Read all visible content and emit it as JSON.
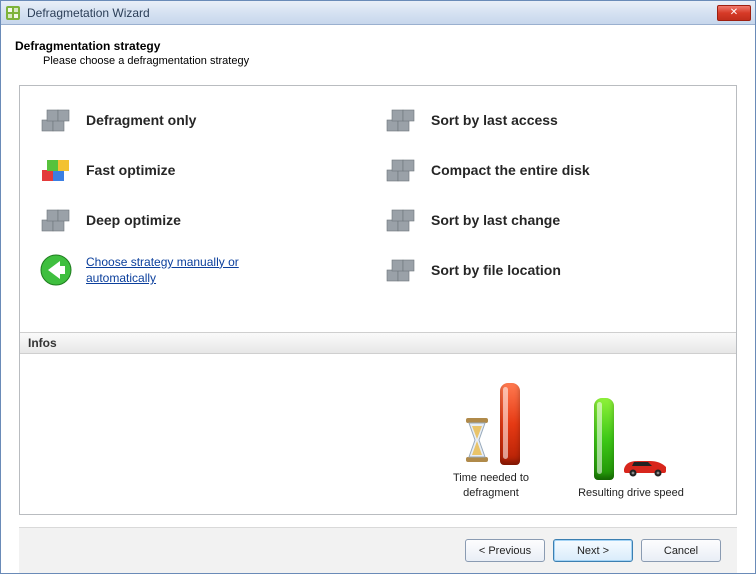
{
  "window": {
    "title": "Defragmetation Wizard"
  },
  "header": {
    "title": "Defragmentation strategy",
    "subtitle": "Please choose a defragmentation strategy"
  },
  "options_left": [
    {
      "label": "Defragment only",
      "icon": "blocks-gray"
    },
    {
      "label": "Fast optimize",
      "icon": "blocks-color"
    },
    {
      "label": "Deep optimize",
      "icon": "blocks-gray"
    }
  ],
  "options_left_link": {
    "label": "Choose strategy manually or automatically",
    "icon": "back-arrow"
  },
  "options_right": [
    {
      "label": "Sort by last access",
      "icon": "blocks-gray"
    },
    {
      "label": "Compact the entire disk",
      "icon": "blocks-gray"
    },
    {
      "label": "Sort by last change",
      "icon": "blocks-gray"
    },
    {
      "label": "Sort by file location",
      "icon": "blocks-gray"
    }
  ],
  "infos": {
    "heading": "Infos",
    "time": {
      "label": "Time needed to defragment"
    },
    "speed": {
      "label": "Resulting drive speed"
    }
  },
  "footer": {
    "prev": "< Previous",
    "next": "Next >",
    "cancel": "Cancel"
  }
}
